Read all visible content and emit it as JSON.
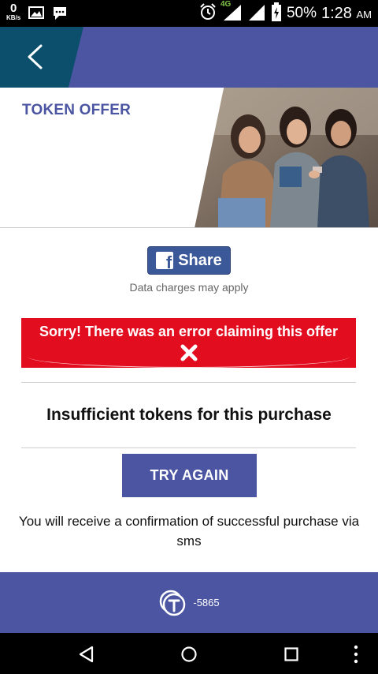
{
  "status_bar": {
    "speed_value": "0",
    "speed_unit": "KB/s",
    "network_type": "4G",
    "battery": "50%",
    "time": "1:28",
    "time_suffix": "AM"
  },
  "offer": {
    "title": "TOKEN OFFER"
  },
  "share": {
    "button_label": "Share",
    "note": "Data charges may apply"
  },
  "error": {
    "message": "Sorry! There was an error claiming this offer"
  },
  "result": {
    "message": "Insufficient tokens for this purchase"
  },
  "actions": {
    "try_again_label": "TRY AGAIN"
  },
  "confirmation": {
    "text": "You will receive a confirmation of successful purchase via sms"
  },
  "footer": {
    "token_count": "-5865"
  },
  "colors": {
    "brand": "#4b55a1",
    "back_zone": "#0b4f6c",
    "error": "#e20d1f",
    "facebook": "#3b5998"
  }
}
